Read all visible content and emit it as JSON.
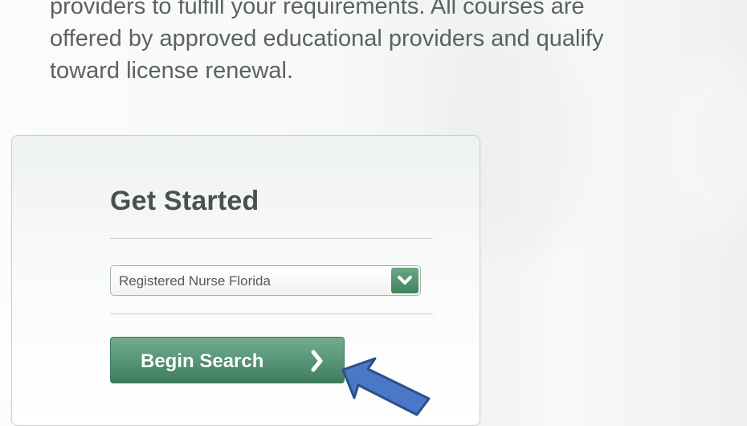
{
  "intro": {
    "line1": "providers to fulfill your requirements. All courses are",
    "line2": "offered by approved educational providers and qualify",
    "line3": "toward license renewal."
  },
  "get_started": {
    "title": "Get Started",
    "license_select": {
      "selected_value": "Registered Nurse Florida",
      "arrow_icon": "chevron-down-icon"
    },
    "begin_button": {
      "label": "Begin Search",
      "icon": "chevron-right-icon"
    }
  },
  "annotation": {
    "pointer": "blue-callout-arrow"
  },
  "colors": {
    "button_green": "#5a977a",
    "dropdown_green": "#4f8e6b",
    "callout_blue": "#4a78c8",
    "text_gray": "#5c6163"
  }
}
